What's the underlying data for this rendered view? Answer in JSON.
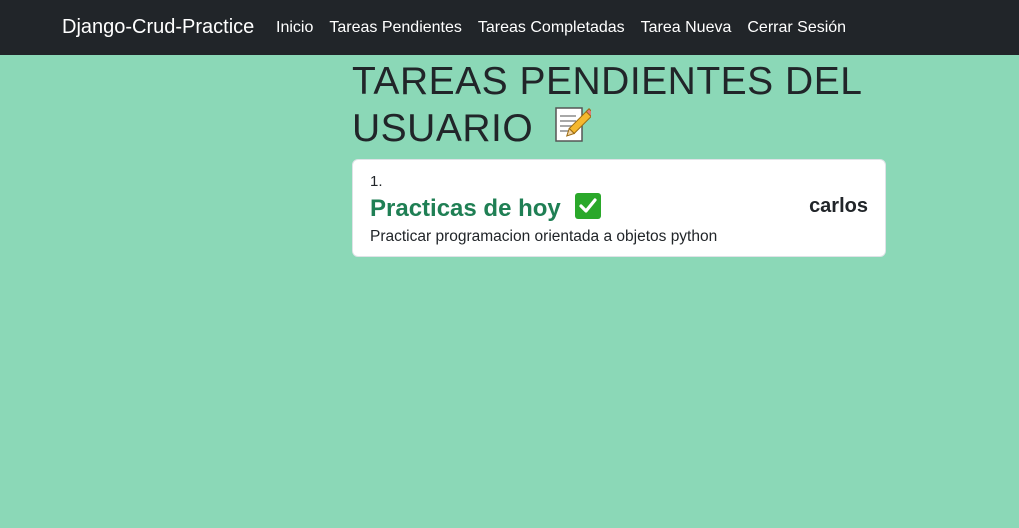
{
  "navbar": {
    "brand": "Django-Crud-Practice",
    "links": [
      {
        "label": "Inicio"
      },
      {
        "label": "Tareas Pendientes"
      },
      {
        "label": "Tareas Completadas"
      },
      {
        "label": "Tarea Nueva"
      },
      {
        "label": "Cerrar Sesión"
      }
    ]
  },
  "main": {
    "title": "TAREAS PENDIENTES DEL USUARIO",
    "title_icon": "memo-icon",
    "tasks": [
      {
        "number": "1.",
        "title": "Practicas de hoy",
        "status_icon": "check-mark-icon",
        "description": "Practicar programacion orientada a objetos python",
        "user": "carlos"
      }
    ]
  },
  "colors": {
    "background": "#8bd8b7",
    "navbar": "#212529",
    "task_title": "#1f7f54",
    "check_icon": "#2aa82a"
  }
}
